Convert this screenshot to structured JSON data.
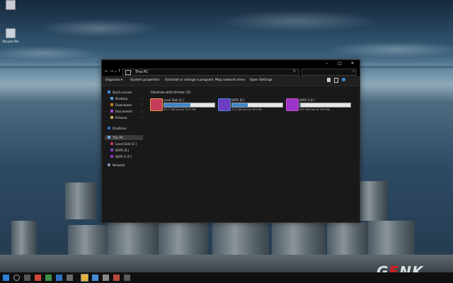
{
  "desktop": {
    "icons": [
      {
        "label": "",
        "icon": "user-folder-icon"
      },
      {
        "label": "Recycle Bin",
        "icon": "recycle-bin-icon"
      }
    ],
    "watermark": {
      "g": "G",
      "e": "E",
      "nk": "NK"
    }
  },
  "explorer": {
    "title": "This PC",
    "address": {
      "crumb": "This PC",
      "chevron": "›",
      "refresh": "↻",
      "search_icon": "⌕"
    },
    "nav": {
      "back": "←",
      "forward": "→",
      "recent": "⌄",
      "up": "↑"
    },
    "window_controls": {
      "minimize": "–",
      "maximize": "□",
      "close": "✕"
    },
    "ribbon": [
      {
        "label": "Organize ▾"
      },
      {
        "label": "System properties"
      },
      {
        "label": "Uninstall or change a program"
      },
      {
        "label": "Map network drive"
      },
      {
        "label": "Open Settings"
      }
    ],
    "sidebar": [
      {
        "label": "Quick access",
        "icon": "star-icon",
        "color": "#3c8fd6",
        "pin": ""
      },
      {
        "label": "Desktop",
        "icon": "desktop-icon",
        "color": "#4ea4e8",
        "pin": "⟋"
      },
      {
        "label": "Downloads",
        "icon": "downloads-icon",
        "color": "#c07a2a",
        "pin": "⟋"
      },
      {
        "label": "Documents",
        "icon": "documents-icon",
        "color": "#9c4bd8",
        "pin": "⟋"
      },
      {
        "label": "Pictures",
        "icon": "pictures-icon",
        "color": "#c5a84a",
        "pin": "⟋"
      },
      {
        "label": "OneDrive",
        "icon": "onedrive-icon",
        "color": "#2b7de9",
        "pin": ""
      },
      {
        "label": "This PC",
        "icon": "this-pc-icon",
        "color": "#6aa6d8",
        "pin": ""
      },
      {
        "label": "Local Disk (C:)",
        "icon": "drive-c-icon",
        "color": "#c43b5c",
        "pin": ""
      },
      {
        "label": "DATA (E:)",
        "icon": "drive-e-icon",
        "color": "#7a43c8",
        "pin": ""
      },
      {
        "label": "DATA 2 (F:)",
        "icon": "drive-f-icon",
        "color": "#8a38c0",
        "pin": ""
      },
      {
        "label": "Network",
        "icon": "network-icon",
        "color": "#8aa6c8",
        "pin": ""
      }
    ],
    "group_title": "Devices and drives (3)",
    "drives": [
      {
        "name": "Local Disk (C:)",
        "free": "35.7 GB free of 75.0 GB",
        "fill": 0.52,
        "color": "#c43b5c",
        "icon": "drive-c-icon"
      },
      {
        "name": "DATA (E:)",
        "free": "113 GB free of 163 GB",
        "fill": 0.31,
        "color": "#6c3cc2",
        "icon": "drive-e-icon"
      },
      {
        "name": "DATA 2 (F:)",
        "free": "287 GB free of 290 GB",
        "fill": 0.02,
        "color": "#9b34c8",
        "icon": "drive-f-icon"
      }
    ]
  },
  "taskbar": {
    "items": [
      "start-icon",
      "search-icon",
      "task-view-icon",
      "app-icon",
      "app-icon",
      "app-icon",
      "app-icon",
      "file-explorer-icon",
      "app-icon",
      "app-icon",
      "app-icon",
      "app-icon"
    ]
  }
}
